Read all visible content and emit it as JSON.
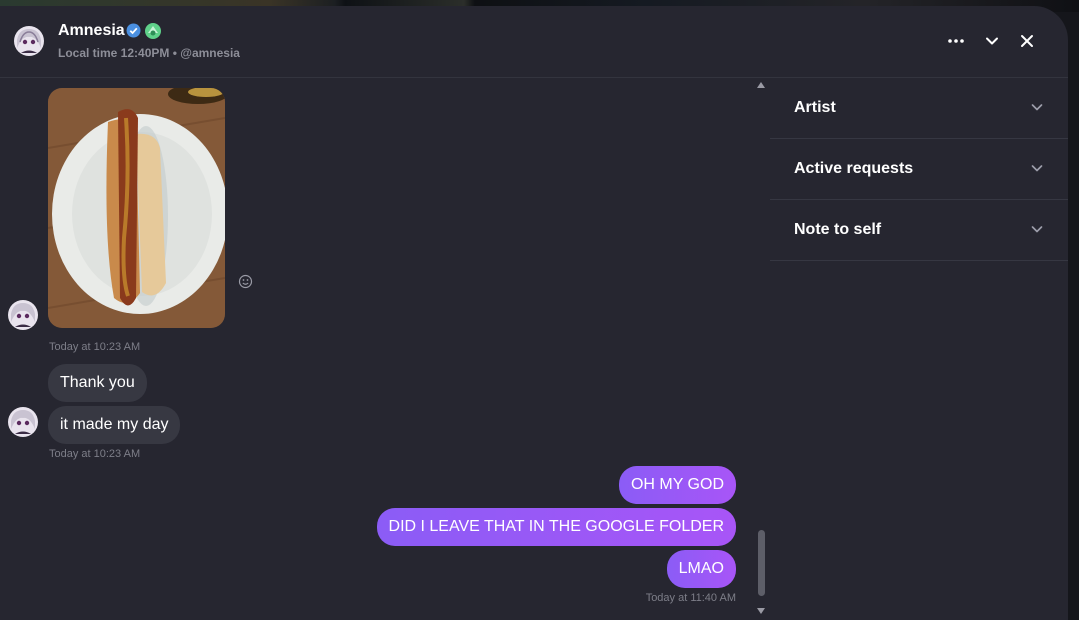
{
  "header": {
    "name": "Amnesia",
    "subtitle": "Local time 12:40PM • @amnesia",
    "icons": [
      "verified-icon",
      "green-badge-icon",
      "more-icon",
      "chevron-down-icon",
      "close-icon"
    ]
  },
  "messages": {
    "incoming_photo_timestamp": "Today at 10:23 AM",
    "incoming_text": [
      "Thank you",
      "it made my day"
    ],
    "incoming_text_timestamp": "Today at 10:23 AM",
    "outgoing_text": [
      "OH MY GOD",
      "DID I LEAVE THAT IN THE GOOGLE FOLDER",
      "LMAO"
    ],
    "outgoing_timestamp": "Today at 11:40 AM"
  },
  "panel": {
    "sections": [
      "Artist",
      "Active requests",
      "Note to self"
    ]
  },
  "colors": {
    "window": "#262630",
    "incoming_bubble": "#373842",
    "outgoing_bubble_from": "#8b5cf6",
    "outgoing_bubble_to": "#a855f7"
  }
}
